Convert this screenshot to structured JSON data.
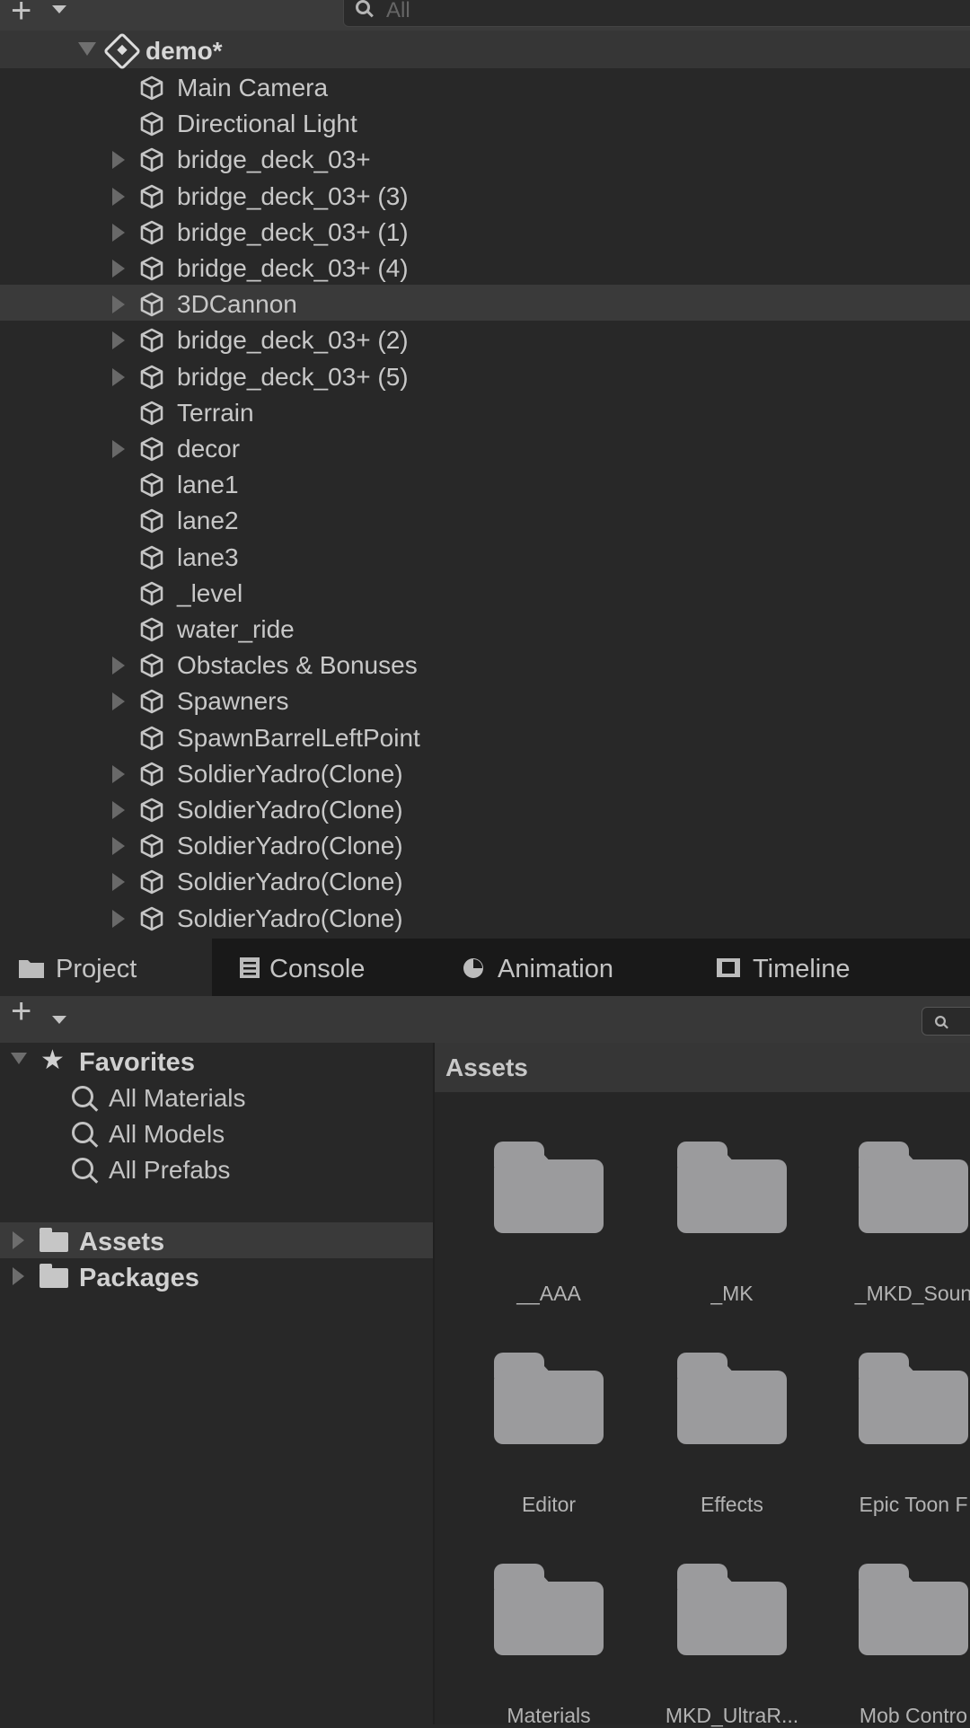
{
  "hierarchy": {
    "search_placeholder": "All",
    "scene_name": "demo*",
    "items": [
      {
        "label": "Main Camera",
        "expandable": false
      },
      {
        "label": "Directional Light",
        "expandable": false
      },
      {
        "label": "bridge_deck_03+",
        "expandable": true
      },
      {
        "label": "bridge_deck_03+ (3)",
        "expandable": true
      },
      {
        "label": "bridge_deck_03+ (1)",
        "expandable": true
      },
      {
        "label": "bridge_deck_03+ (4)",
        "expandable": true
      },
      {
        "label": "3DCannon",
        "expandable": true,
        "highlighted": true
      },
      {
        "label": "bridge_deck_03+ (2)",
        "expandable": true
      },
      {
        "label": "bridge_deck_03+ (5)",
        "expandable": true
      },
      {
        "label": "Terrain",
        "expandable": false
      },
      {
        "label": "decor",
        "expandable": true
      },
      {
        "label": "lane1",
        "expandable": false
      },
      {
        "label": "lane2",
        "expandable": false
      },
      {
        "label": "lane3",
        "expandable": false
      },
      {
        "label": "_level",
        "expandable": false
      },
      {
        "label": "water_ride",
        "expandable": false
      },
      {
        "label": "Obstacles & Bonuses",
        "expandable": true
      },
      {
        "label": "Spawners",
        "expandable": true
      },
      {
        "label": "SpawnBarrelLeftPoint",
        "expandable": false
      },
      {
        "label": "SoldierYadro(Clone)",
        "expandable": true
      },
      {
        "label": "SoldierYadro(Clone)",
        "expandable": true
      },
      {
        "label": "SoldierYadro(Clone)",
        "expandable": true
      },
      {
        "label": "SoldierYadro(Clone)",
        "expandable": true
      },
      {
        "label": "SoldierYadro(Clone)",
        "expandable": true
      }
    ]
  },
  "tabs": [
    {
      "label": "Project",
      "icon": "folder-icon",
      "active": true
    },
    {
      "label": "Console",
      "icon": "console-icon",
      "active": false
    },
    {
      "label": "Animation",
      "icon": "animation-icon",
      "active": false
    },
    {
      "label": "Timeline",
      "icon": "timeline-icon",
      "active": false
    }
  ],
  "project": {
    "favorites_label": "Favorites",
    "favorites": [
      "All Materials",
      "All Models",
      "All Prefabs"
    ],
    "roots": [
      {
        "label": "Assets",
        "selected": true
      },
      {
        "label": "Packages",
        "selected": false
      }
    ],
    "current_folder": "Assets",
    "folders": [
      "__AAA",
      "_MK",
      "_MKD_Soun",
      "Editor",
      "Effects",
      "Epic Toon F",
      "Materials",
      "MKD_UltraR...",
      "Mob Contro"
    ]
  }
}
